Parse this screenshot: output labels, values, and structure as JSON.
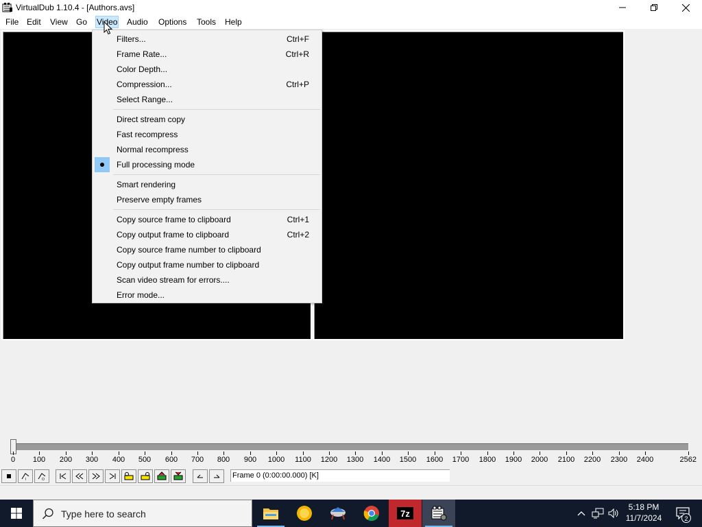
{
  "window": {
    "title": "VirtualDub 1.10.4 - [Authors.avs]"
  },
  "menubar": {
    "items": [
      {
        "label": "File"
      },
      {
        "label": "Edit"
      },
      {
        "label": "View"
      },
      {
        "label": "Go"
      },
      {
        "label": "Video"
      },
      {
        "label": "Audio"
      },
      {
        "label": "Options"
      },
      {
        "label": "Tools"
      },
      {
        "label": "Help"
      }
    ],
    "active": "Video"
  },
  "video_menu": {
    "items": [
      {
        "label": "Filters...",
        "shortcut": "Ctrl+F"
      },
      {
        "label": "Frame Rate...",
        "shortcut": "Ctrl+R"
      },
      {
        "label": "Color Depth...",
        "shortcut": ""
      },
      {
        "label": "Compression...",
        "shortcut": "Ctrl+P"
      },
      {
        "label": "Select Range...",
        "shortcut": ""
      },
      {
        "label": "Direct stream copy",
        "shortcut": ""
      },
      {
        "label": "Fast recompress",
        "shortcut": ""
      },
      {
        "label": "Normal recompress",
        "shortcut": ""
      },
      {
        "label": "Full processing mode",
        "shortcut": "",
        "checked": true
      },
      {
        "label": "Smart rendering",
        "shortcut": ""
      },
      {
        "label": "Preserve empty frames",
        "shortcut": ""
      },
      {
        "label": "Copy source frame to clipboard",
        "shortcut": "Ctrl+1"
      },
      {
        "label": "Copy output frame to clipboard",
        "shortcut": "Ctrl+2"
      },
      {
        "label": "Copy source frame number to clipboard",
        "shortcut": ""
      },
      {
        "label": "Copy output frame number to clipboard",
        "shortcut": ""
      },
      {
        "label": "Scan video stream for errors....",
        "shortcut": ""
      },
      {
        "label": "Error mode...",
        "shortcut": ""
      }
    ]
  },
  "timeline": {
    "labels": [
      "0",
      "100",
      "200",
      "300",
      "400",
      "500",
      "600",
      "700",
      "800",
      "900",
      "1000",
      "1100",
      "1200",
      "1300",
      "1400",
      "1500",
      "1600",
      "1700",
      "1800",
      "1900",
      "2000",
      "2100",
      "2200",
      "2300",
      "2400",
      "2562"
    ],
    "position": 0
  },
  "toolbar": {
    "frame_text": "Frame 0 (0:00:00.000) [K]"
  },
  "taskbar": {
    "search_placeholder": "Type here to search",
    "time": "5:18 PM",
    "date": "11/7/2024",
    "notification_count": "2"
  },
  "colors": {
    "menu_highlight": "#cce8ff",
    "checked_item_bg": "#90c8f6",
    "taskbar_bg": "#101a2a"
  }
}
